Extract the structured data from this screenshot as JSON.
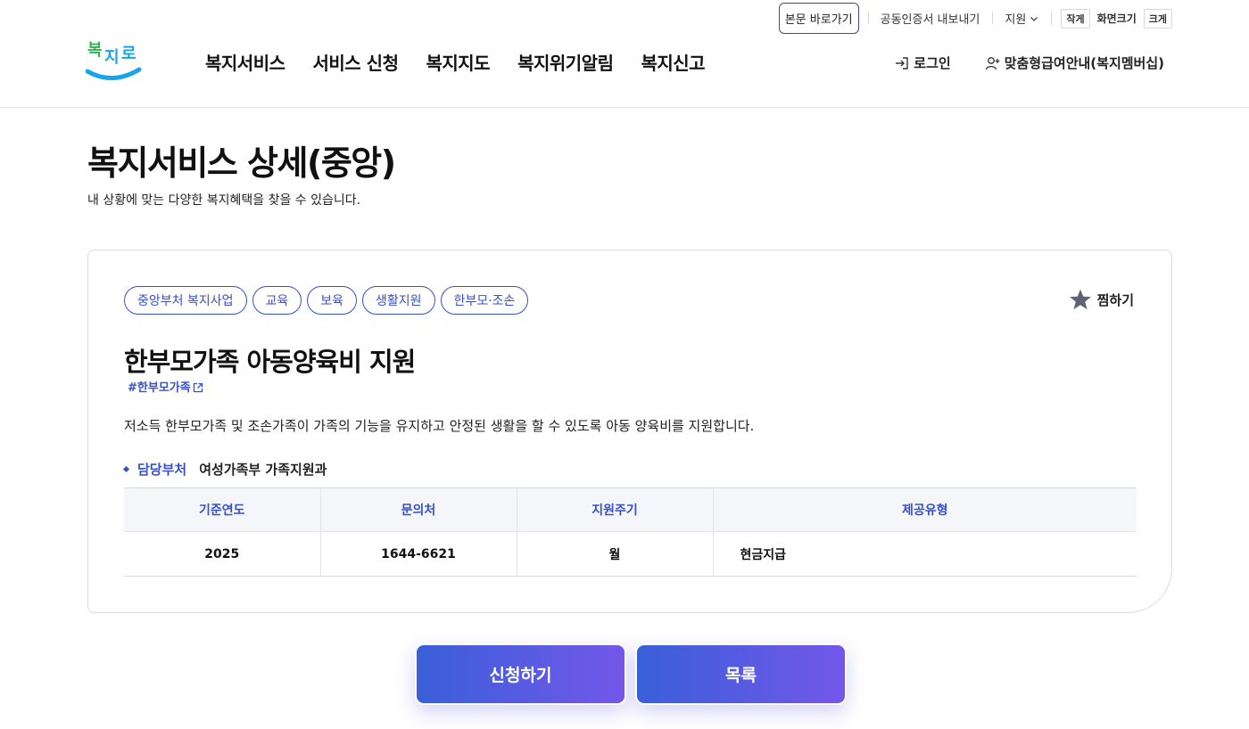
{
  "header": {
    "skip_link": "본문 바로가기",
    "cert_export": "공동인증서 내보내기",
    "support": "지원",
    "font_small": "작게",
    "font_label": "화면크기",
    "font_large": "크게",
    "logo_text": "복지로",
    "nav": [
      "복지서비스",
      "서비스 신청",
      "복지지도",
      "복지위기알림",
      "복지신고"
    ],
    "login": "로그인",
    "membership": "맞춤형급여안내(복지멤버십)"
  },
  "page": {
    "title": "복지서비스 상세(중앙)",
    "description": "내 상황에 맞는 다양한 복지혜택을 찾을 수 있습니다."
  },
  "service": {
    "tags": [
      "중앙부처 복지사업",
      "교육",
      "보육",
      "생활지원",
      "한부모·조손"
    ],
    "bookmark": "찜하기",
    "title": "한부모가족 아동양육비 지원",
    "hashtag": "#한부모가족",
    "description": "저소득 한부모가족 및 조손가족이 가족의 기능을 유지하고 안정된 생활을 할 수 있도록 아동 양육비를 지원합니다.",
    "dept_label": "담당부처",
    "dept_value": "여성가족부 가족지원과",
    "table": {
      "headers": [
        "기준연도",
        "문의처",
        "지원주기",
        "제공유형"
      ],
      "row": [
        "2025",
        "1644-6621",
        "월",
        "현금지급"
      ]
    }
  },
  "actions": {
    "apply": "신청하기",
    "list": "목록"
  },
  "colors": {
    "accent": "#3750c8",
    "button_gradient_start": "#3a5fd9",
    "button_gradient_end": "#7357ea",
    "logo_blue": "#1aa4e8"
  }
}
